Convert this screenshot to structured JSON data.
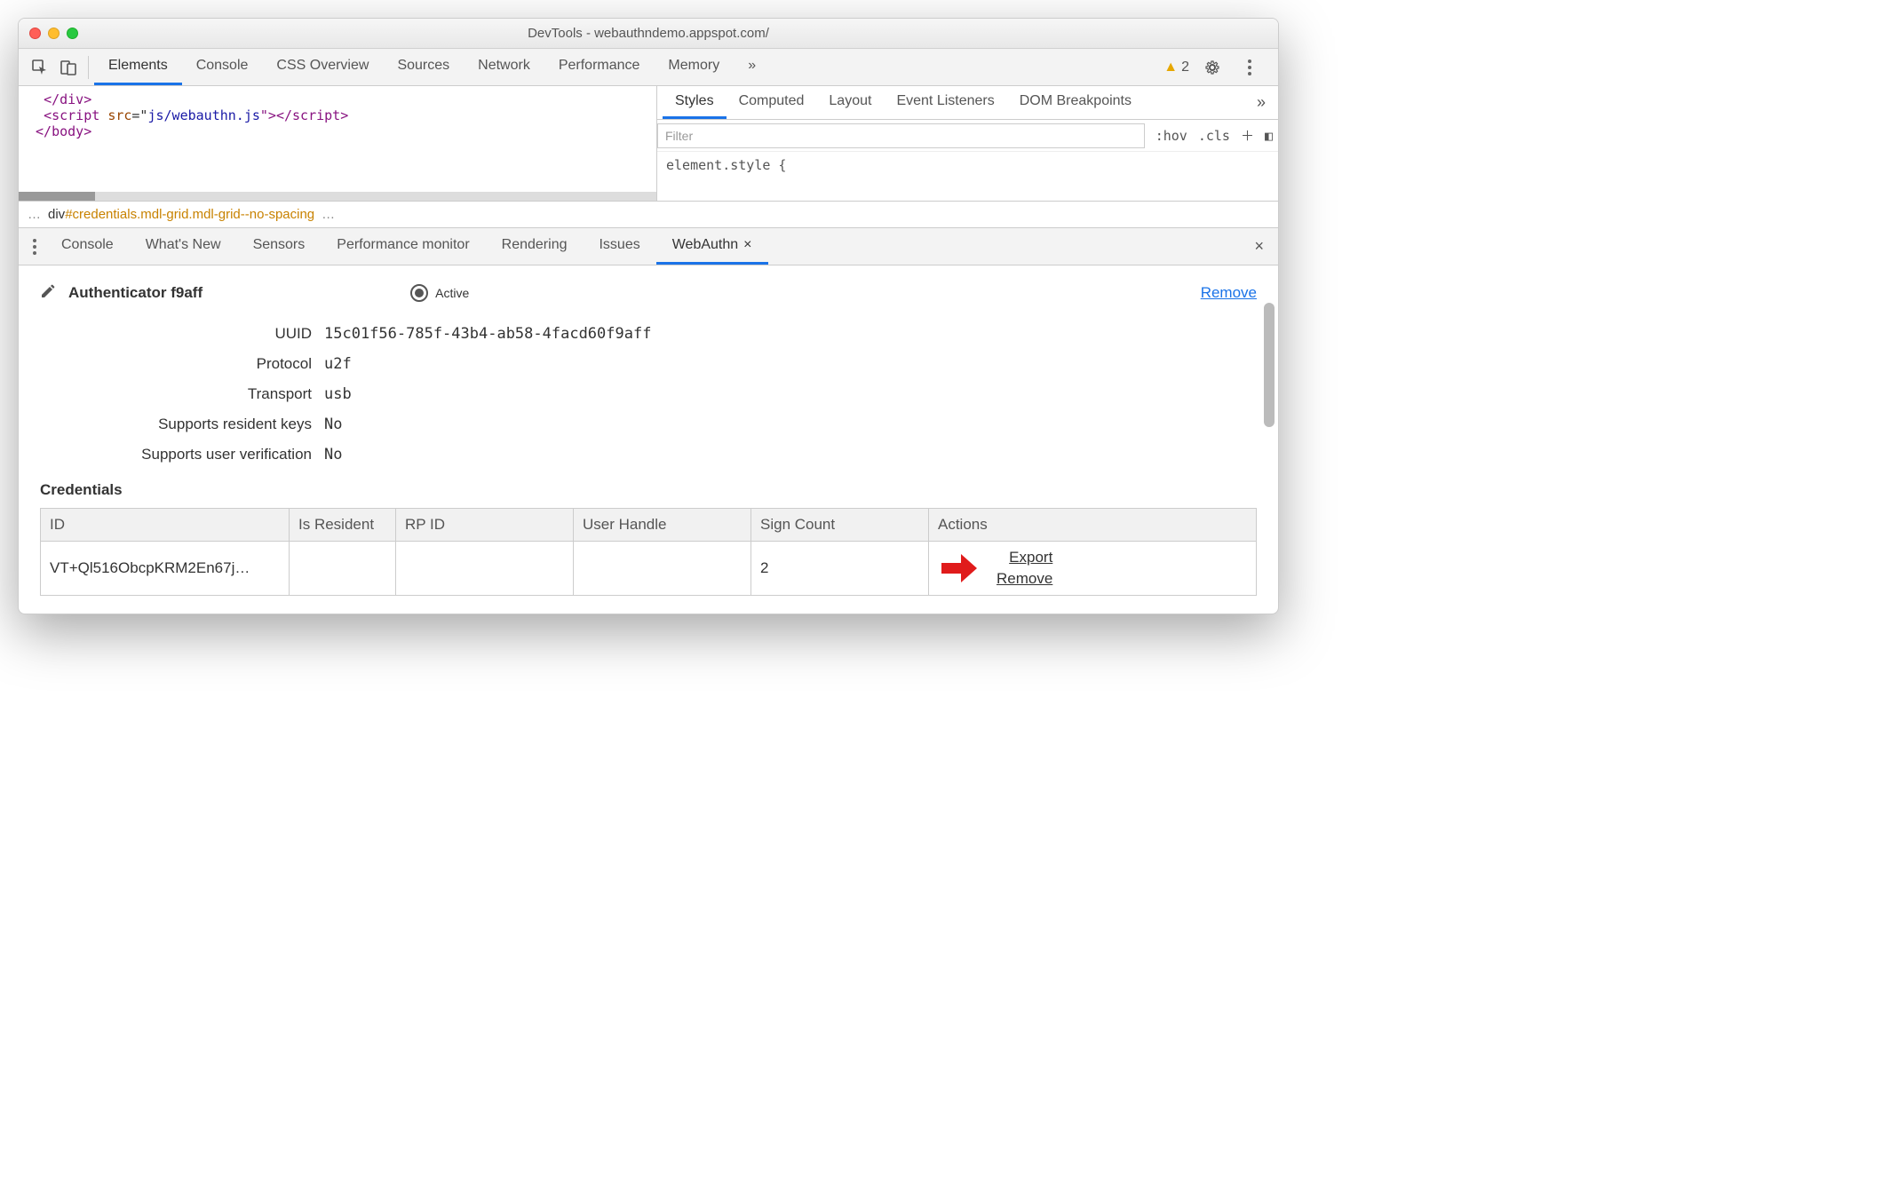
{
  "window": {
    "title": "DevTools - webauthndemo.appspot.com/"
  },
  "toolbar": {
    "tabs": [
      "Elements",
      "Console",
      "CSS Overview",
      "Sources",
      "Network",
      "Performance",
      "Memory"
    ],
    "active_tab": "Elements",
    "more": "»",
    "warning_count": "2"
  },
  "elements_code": {
    "line1_close": "</div>",
    "line2_open": "<script ",
    "line2_attr": "src",
    "line2_eq": "=\"",
    "line2_val": "js/webauthn.js",
    "line2_end": "\"></scr",
    "line2_end2": "ipt>",
    "line3": "</body>"
  },
  "breadcrumb": {
    "dots": "…",
    "el": "div",
    "id": "#credentials",
    "classes": ".mdl-grid.mdl-grid--no-spacing",
    "trail": "…"
  },
  "styles": {
    "tabs": [
      "Styles",
      "Computed",
      "Layout",
      "Event Listeners",
      "DOM Breakpoints"
    ],
    "active": "Styles",
    "more": "»",
    "filter_placeholder": "Filter",
    "hov": ":hov",
    "cls": ".cls",
    "body": "element.style {"
  },
  "drawer": {
    "tabs": [
      "Console",
      "What's New",
      "Sensors",
      "Performance monitor",
      "Rendering",
      "Issues",
      "WebAuthn"
    ],
    "active": "WebAuthn"
  },
  "webauthn": {
    "title": "Authenticator f9aff",
    "active_label": "Active",
    "remove": "Remove",
    "props": {
      "uuid_label": "UUID",
      "uuid": "15c01f56-785f-43b4-ab58-4facd60f9aff",
      "protocol_label": "Protocol",
      "protocol": "u2f",
      "transport_label": "Transport",
      "transport": "usb",
      "resident_label": "Supports resident keys",
      "resident": "No",
      "uv_label": "Supports user verification",
      "uv": "No"
    },
    "credentials_heading": "Credentials",
    "columns": {
      "id": "ID",
      "is_resident": "Is Resident",
      "rp_id": "RP ID",
      "user_handle": "User Handle",
      "sign_count": "Sign Count",
      "actions": "Actions"
    },
    "row": {
      "id": "VT+Ql516ObcpKRM2En67j…",
      "is_resident": "",
      "rp_id": "",
      "user_handle": "",
      "sign_count": "2",
      "export": "Export",
      "remove": "Remove"
    }
  }
}
